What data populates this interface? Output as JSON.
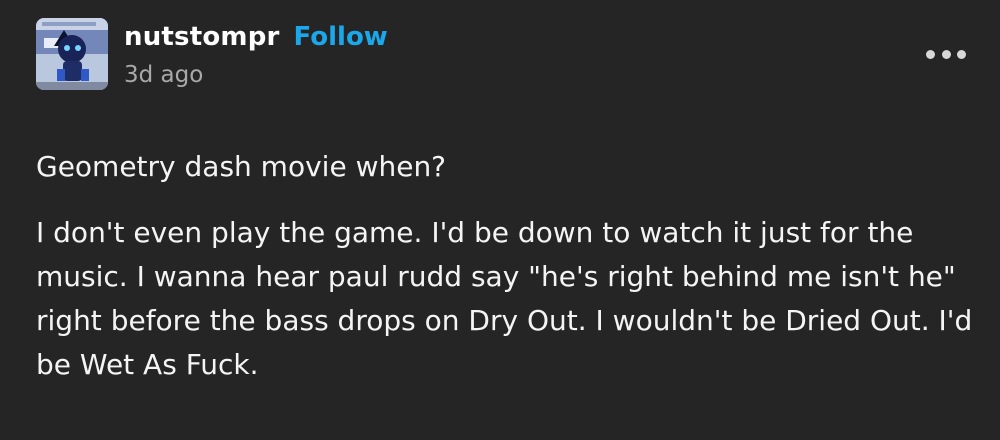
{
  "post": {
    "author": {
      "username": "nutstompr",
      "follow_label": "Follow",
      "timestamp": "3d ago",
      "avatar_icon": "user-avatar"
    },
    "more_icon": "more-horizontal-icon",
    "paragraphs": [
      "Geometry dash movie when?",
      "I don't even play the game. I'd be down to watch it just for the music. I wanna hear paul rudd say \"he's right behind me isn't he\" right before the bass drops on Dry Out. I wouldn't be Dried Out. I'd be Wet As Fuck."
    ]
  },
  "colors": {
    "background": "#252525",
    "text": "#f4f4f4",
    "follow": "#1ba8ea",
    "timestamp": "#a9a9a9"
  }
}
